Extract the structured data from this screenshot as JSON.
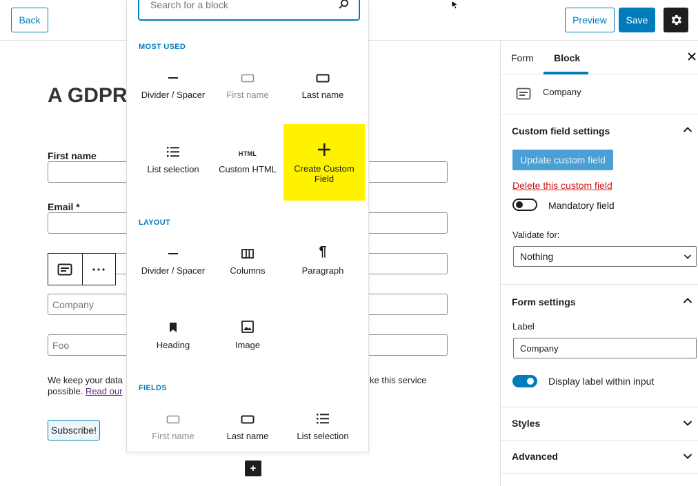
{
  "topbar": {
    "back_label": "Back",
    "preview_label": "Preview",
    "save_label": "Save"
  },
  "editor": {
    "title": "A GDPR",
    "fields": [
      {
        "label": "First name",
        "placeholder": ""
      },
      {
        "label": "Email *",
        "placeholder": ""
      },
      {
        "label": "",
        "placeholder": ""
      },
      {
        "label": "",
        "placeholder": "Company"
      },
      {
        "label": "",
        "placeholder": "Foo"
      }
    ],
    "gdpr_text_start": "We keep your data",
    "gdpr_text_end": "ke this service",
    "gdpr_text_line2": "possible.",
    "gdpr_link": "Read our",
    "subscribe_label": "Subscribe!",
    "add_block_label": "+"
  },
  "inserter": {
    "search_placeholder": "Search for a block",
    "sections": {
      "most_used": "MOST USED",
      "layout": "LAYOUT",
      "fields": "FIELDS"
    },
    "most_used_blocks": [
      {
        "label": "Divider / Spacer",
        "icon": "divider-icon"
      },
      {
        "label": "First name",
        "icon": "input-field-icon",
        "disabled": true
      },
      {
        "label": "Last name",
        "icon": "input-field-icon"
      },
      {
        "label": "List selection",
        "icon": "list-icon"
      },
      {
        "label": "Custom HTML",
        "icon": "html-icon"
      },
      {
        "label": "Create Custom Field",
        "icon": "plus-icon",
        "highlight": "#fff200"
      }
    ],
    "layout_blocks": [
      {
        "label": "Divider / Spacer",
        "icon": "divider-icon"
      },
      {
        "label": "Columns",
        "icon": "columns-icon"
      },
      {
        "label": "Paragraph",
        "icon": "paragraph-icon"
      },
      {
        "label": "Heading",
        "icon": "bookmark-icon"
      },
      {
        "label": "Image",
        "icon": "image-icon"
      }
    ],
    "field_blocks": [
      {
        "label": "First name",
        "icon": "input-field-icon",
        "disabled": true
      },
      {
        "label": "Last name",
        "icon": "input-field-icon"
      },
      {
        "label": "List selection",
        "icon": "list-icon"
      }
    ]
  },
  "sidebar": {
    "tabs": [
      "Form",
      "Block"
    ],
    "active_tab": "Block",
    "block_name": "Company",
    "custom_field_settings": {
      "title": "Custom field settings",
      "update_label": "Update custom field",
      "delete_label": "Delete this custom field",
      "mandatory_label": "Mandatory field",
      "mandatory_on": false,
      "validate_label": "Validate for:",
      "validate_value": "Nothing"
    },
    "form_settings": {
      "title": "Form settings",
      "label_caption": "Label",
      "label_value": "Company",
      "display_label_text": "Display label within input",
      "display_label_on": true
    },
    "styles_title": "Styles",
    "advanced_title": "Advanced"
  },
  "colors": {
    "accent": "#007cba",
    "highlight": "#fff200",
    "danger": "#cc1818"
  }
}
